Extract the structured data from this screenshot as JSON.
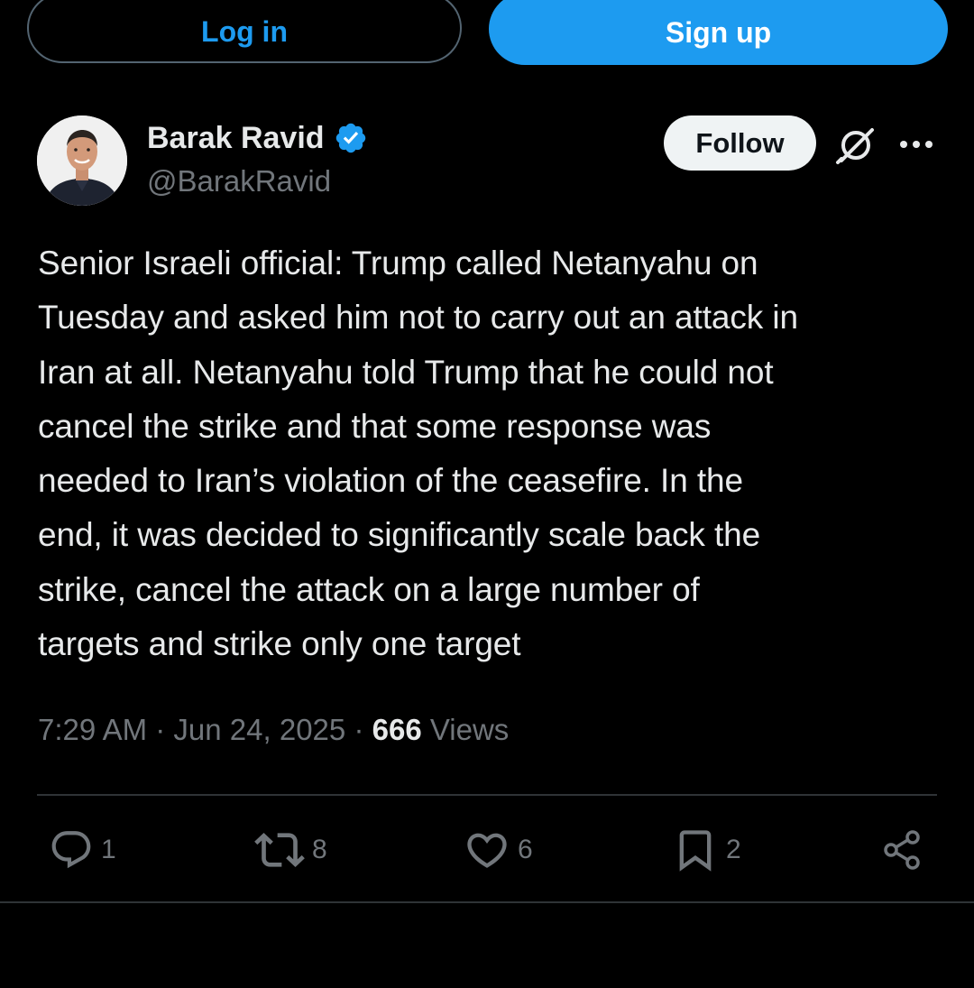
{
  "auth": {
    "login_label": "Log in",
    "signup_label": "Sign up"
  },
  "author": {
    "name": "Barak Ravid",
    "handle": "@BarakRavid",
    "verified": true
  },
  "header_actions": {
    "follow_label": "Follow",
    "grok_icon": "grok-icon",
    "more_icon": "more-icon"
  },
  "tweet": {
    "text_lines": [
      "Senior Israeli official: Trump called Netanyahu on",
      "Tuesday and asked him not to carry out an attack in",
      "Iran at all. Netanyahu told Trump that he could not",
      "cancel the strike and that some response was",
      "needed to Iran’s violation of the ceasefire. In the",
      "end, it was decided to significantly scale back the",
      "strike, cancel the attack on a large number of",
      "targets and strike only one target"
    ],
    "time": "7:29 AM",
    "date": "Jun 24, 2025",
    "separator": "·",
    "views_count": "666",
    "views_label": "Views"
  },
  "engagement": {
    "replies": "1",
    "reposts": "8",
    "likes": "6",
    "bookmarks": "2",
    "share_icon": "share-icon"
  },
  "colors": {
    "background": "#000000",
    "accent": "#1d9bf0",
    "text_primary": "#e7e9ea",
    "text_secondary": "#71767b",
    "divider": "#2f3336",
    "follow_bg": "#eff3f4"
  }
}
